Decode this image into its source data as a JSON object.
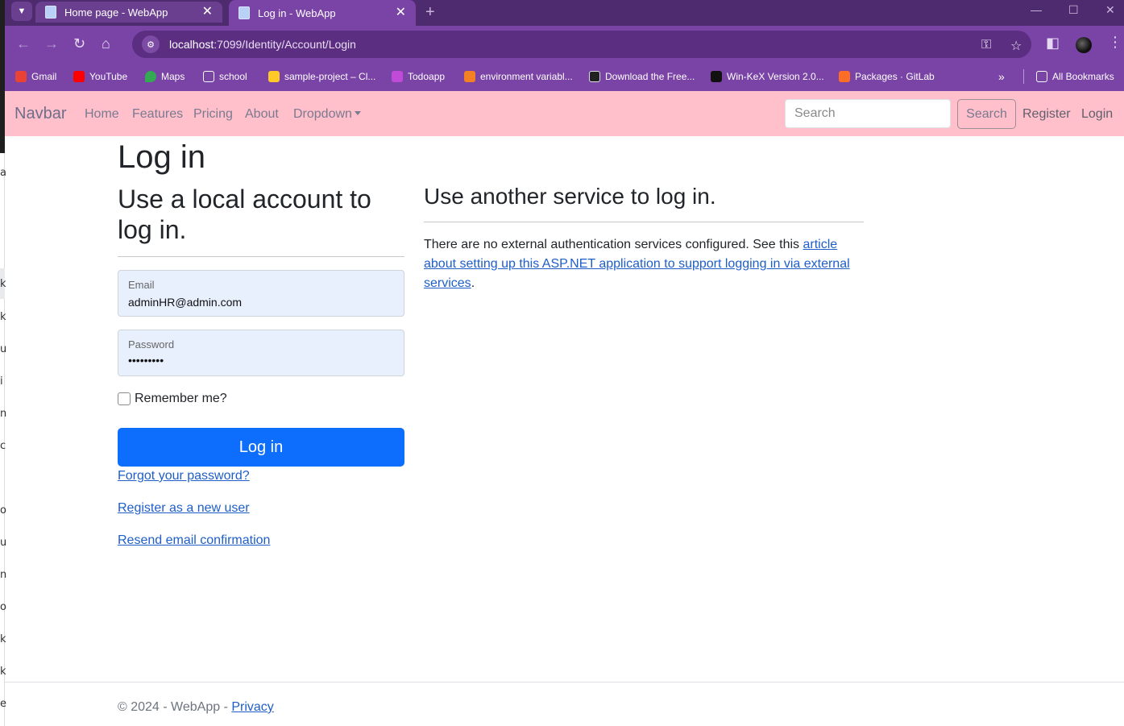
{
  "browser": {
    "tabs": [
      {
        "title": "Home page - WebApp",
        "active": false
      },
      {
        "title": "Log in - WebApp",
        "active": true
      }
    ],
    "url_host": "localhost",
    "url_path": ":7099/Identity/Account/Login",
    "bookmarks": [
      {
        "label": "Gmail",
        "icon": "gmail-icon",
        "color": "#ea4335"
      },
      {
        "label": "YouTube",
        "icon": "youtube-icon",
        "color": "#ff0000"
      },
      {
        "label": "Maps",
        "icon": "maps-icon",
        "color": "#34a853"
      },
      {
        "label": "school",
        "icon": "folder-icon",
        "color": "#7a43a6"
      },
      {
        "label": "sample-project – Cl...",
        "icon": "firebase-icon",
        "color": "#ffca28"
      },
      {
        "label": "Todoapp",
        "icon": "todoapp-icon",
        "color": "#c04bd8"
      },
      {
        "label": "environment variabl...",
        "icon": "stackoverflow-icon",
        "color": "#f48024"
      },
      {
        "label": "Download the Free...",
        "icon": "eye-icon",
        "color": "#222222"
      },
      {
        "label": "Win-KeX Version 2.0...",
        "icon": "kali-icon",
        "color": "#111111"
      },
      {
        "label": "Packages · GitLab",
        "icon": "gitlab-icon",
        "color": "#fc6d26"
      }
    ],
    "all_bookmarks": "All Bookmarks"
  },
  "navbar": {
    "brand": "Navbar",
    "links": [
      "Home",
      "Features",
      "Pricing",
      "About",
      "Dropdown"
    ],
    "search_placeholder": "Search",
    "search_button": "Search",
    "register": "Register",
    "login": "Login"
  },
  "main": {
    "title": "Log in",
    "local_heading": "Use a local account to log in.",
    "email_label": "Email",
    "email_value": "adminHR@admin.com",
    "password_label": "Password",
    "password_mask": "•••••••••",
    "remember_label": "Remember me?",
    "remember_checked": false,
    "login_button": "Log in",
    "forgot_link": "Forgot your password?",
    "register_link": "Register as a new user",
    "resend_link": "Resend email confirmation"
  },
  "external": {
    "heading": "Use another service to log in.",
    "text_before": "There are no external authentication services configured. See this ",
    "link_text": "article about setting up this ASP.NET application to support logging in via external services",
    "text_after": "."
  },
  "footer": {
    "text": "© 2024 - WebApp - ",
    "privacy": "Privacy"
  },
  "colors": {
    "navbar_bg": "#ffc0cb",
    "primary": "#0d6efd",
    "browser_theme": "#7a43a6"
  }
}
